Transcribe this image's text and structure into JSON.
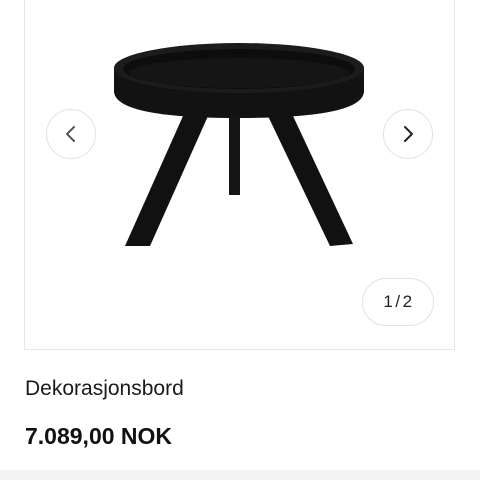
{
  "gallery": {
    "counter_current": "1",
    "counter_separator": "/",
    "counter_total": "2",
    "prev_icon": "chevron-left-icon",
    "next_icon": "chevron-right-icon"
  },
  "product": {
    "name": "Dekorasjonsbord",
    "price": "7.089,00 NOK"
  },
  "colors": {
    "product_color": "#111111",
    "border": "#e6e6e6"
  }
}
